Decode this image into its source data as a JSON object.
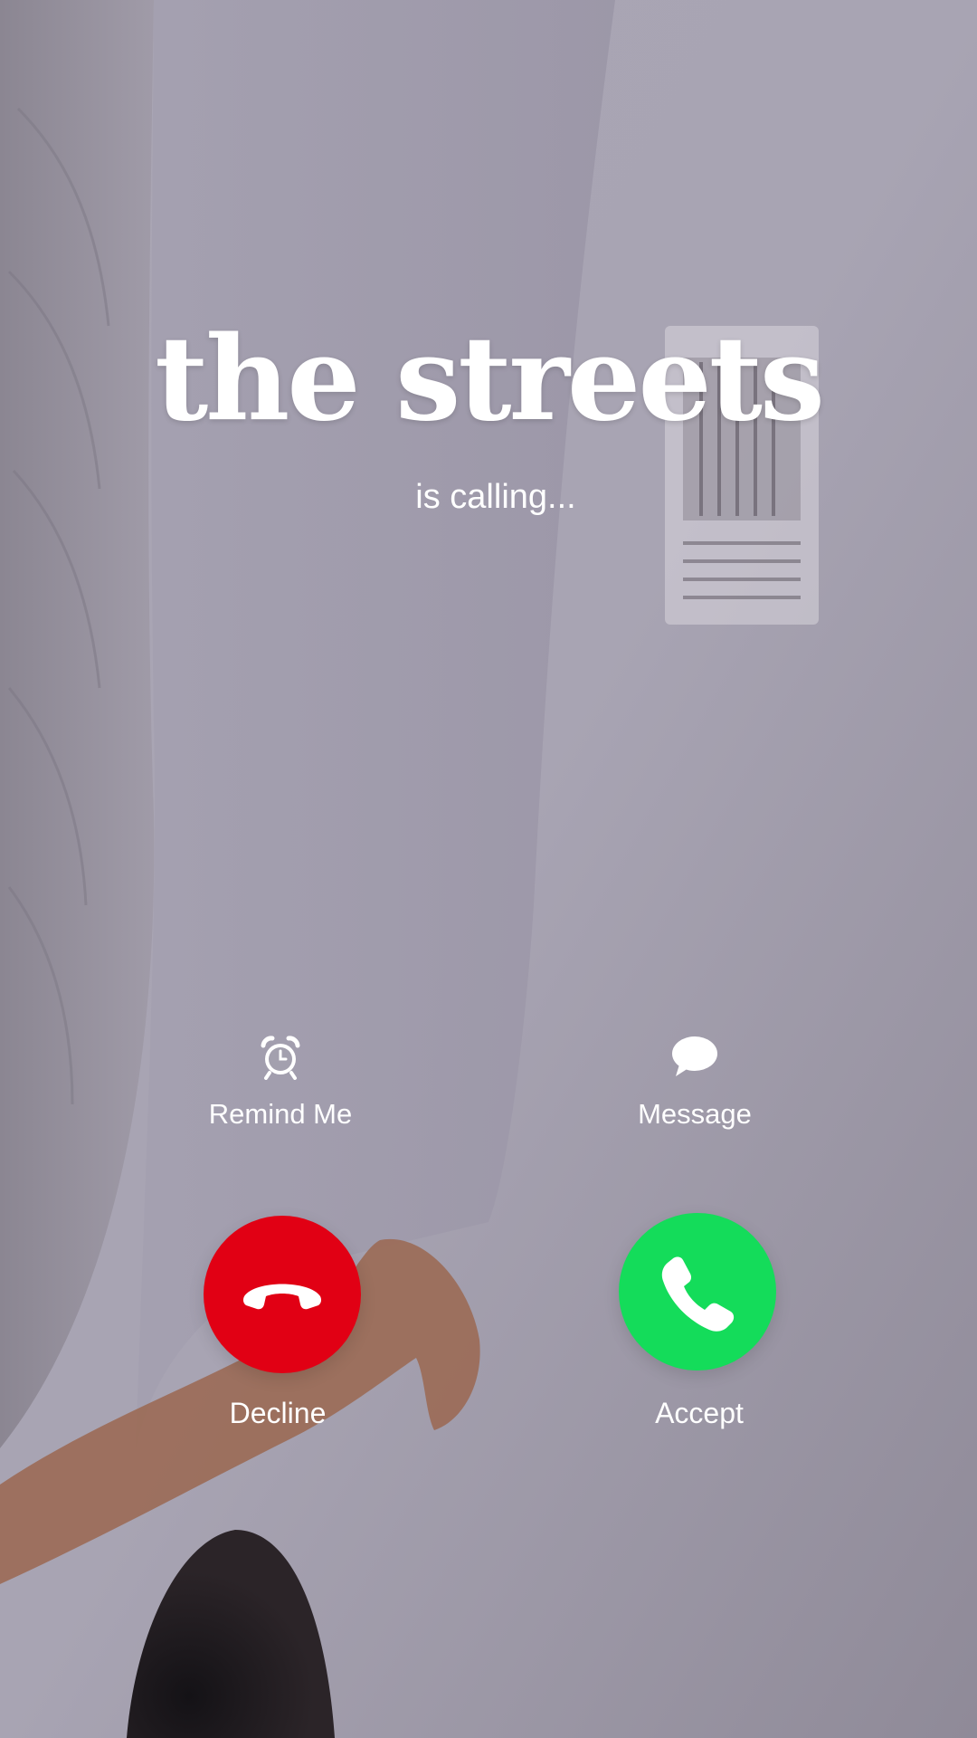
{
  "caller": {
    "name": "the streets",
    "status": "is calling..."
  },
  "quick_actions": {
    "remind_label": "Remind Me",
    "remind_icon": "alarm-clock-icon",
    "message_label": "Message",
    "message_icon": "speech-bubble-icon"
  },
  "call_buttons": {
    "decline_label": "Decline",
    "decline_icon": "phone-hangup-icon",
    "accept_label": "Accept",
    "accept_icon": "phone-icon"
  },
  "colors": {
    "decline": "#e10014",
    "accept": "#14dc5a",
    "text": "#ffffff",
    "background": "#a39fae"
  }
}
